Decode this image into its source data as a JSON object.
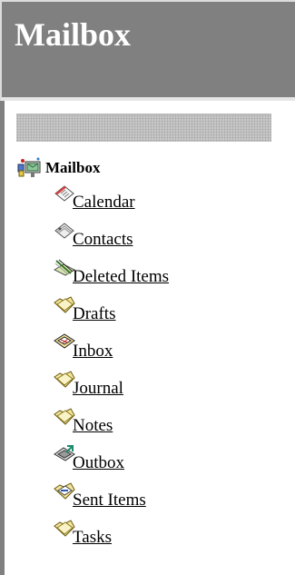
{
  "header": {
    "title": "Mailbox"
  },
  "tree": {
    "root": {
      "label": "Mailbox",
      "icon": "mailbox-icon"
    },
    "folders": [
      {
        "label": "Calendar",
        "icon": "calendar-icon"
      },
      {
        "label": "Contacts",
        "icon": "contacts-icon"
      },
      {
        "label": "Deleted Items",
        "icon": "deleted-items-icon"
      },
      {
        "label": "Drafts",
        "icon": "drafts-folder-icon"
      },
      {
        "label": "Inbox",
        "icon": "inbox-icon"
      },
      {
        "label": "Journal",
        "icon": "journal-folder-icon"
      },
      {
        "label": "Notes",
        "icon": "notes-folder-icon"
      },
      {
        "label": "Outbox",
        "icon": "outbox-icon"
      },
      {
        "label": "Sent Items",
        "icon": "sent-items-icon"
      },
      {
        "label": "Tasks",
        "icon": "tasks-folder-icon"
      }
    ]
  },
  "colors": {
    "header_background": "#808080",
    "header_text": "#ffffff",
    "panel_background": "#ffffff",
    "link_text": "#000000",
    "folder_yellow": "#f3e59a",
    "folder_outline": "#6b5a10"
  }
}
